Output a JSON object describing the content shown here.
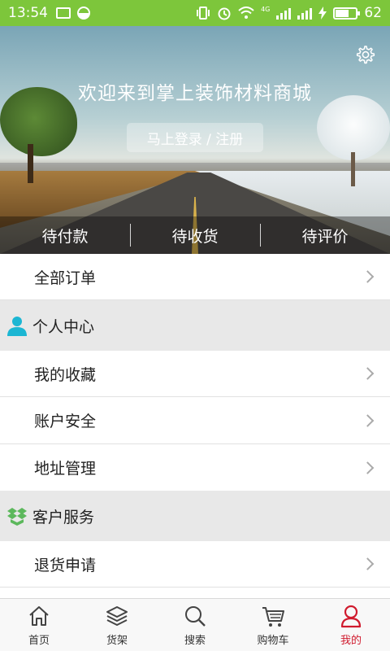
{
  "status_bar": {
    "time": "13:54",
    "network": "4G",
    "battery": "62",
    "battery_level": 0.62,
    "color": "#7dc63b"
  },
  "hero": {
    "title": "欢迎来到掌上装饰材料商城",
    "login_label": "马上登录 / 注册",
    "settings_icon": "gear-icon",
    "order_tabs": [
      {
        "label": "待付款"
      },
      {
        "label": "待收货"
      },
      {
        "label": "待评价"
      }
    ]
  },
  "list": {
    "all_orders": "全部订单",
    "personal_center": {
      "title": "个人中心",
      "icon": "person-icon",
      "icon_color": "#1bb6d3",
      "items": [
        {
          "label": "我的收藏"
        },
        {
          "label": "账户安全"
        },
        {
          "label": "地址管理"
        }
      ]
    },
    "customer_service": {
      "title": "客户服务",
      "icon": "box-icon",
      "icon_color": "#5cb85c",
      "items": [
        {
          "label": "退货申请"
        }
      ]
    }
  },
  "bottom_nav": {
    "active_color": "#d01b2e",
    "items": [
      {
        "label": "首页",
        "icon": "home-icon"
      },
      {
        "label": "货架",
        "icon": "layers-icon"
      },
      {
        "label": "搜索",
        "icon": "search-icon"
      },
      {
        "label": "购物车",
        "icon": "cart-icon"
      },
      {
        "label": "我的",
        "icon": "user-icon",
        "active": true
      }
    ]
  }
}
